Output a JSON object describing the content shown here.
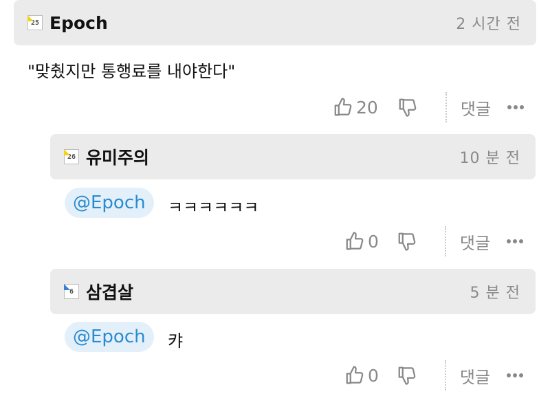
{
  "comments": [
    {
      "level": "25",
      "level_color": "#f2d21b",
      "username": "Epoch",
      "time": "2 시간 전",
      "text": "\"맞췄지만 통행료를 내야한다\"",
      "likes": "20",
      "reply_label": "댓글",
      "icons": [
        "thumbs-up-icon",
        "thumbs-down-icon",
        "more-icon"
      ]
    },
    {
      "level": "26",
      "level_color": "#f2d21b",
      "username": "유미주의",
      "time": "10 분 전",
      "mention": "@Epoch",
      "text": "ㅋㅋㅋㅋㅋㅋ",
      "likes": "0",
      "reply_label": "댓글",
      "icons": [
        "thumbs-up-icon",
        "thumbs-down-icon",
        "more-icon"
      ]
    },
    {
      "level": "6",
      "level_color": "#3a7fd5",
      "username": "삼겹살",
      "time": "5 분 전",
      "mention": "@Epoch",
      "text": "캬",
      "likes": "0",
      "reply_label": "댓글",
      "icons": [
        "thumbs-up-icon",
        "thumbs-down-icon",
        "more-icon"
      ]
    }
  ],
  "colors": {
    "header_bg": "#ebebeb",
    "mention_bg": "#e3f0fa",
    "mention_text": "#2a8ad0"
  }
}
